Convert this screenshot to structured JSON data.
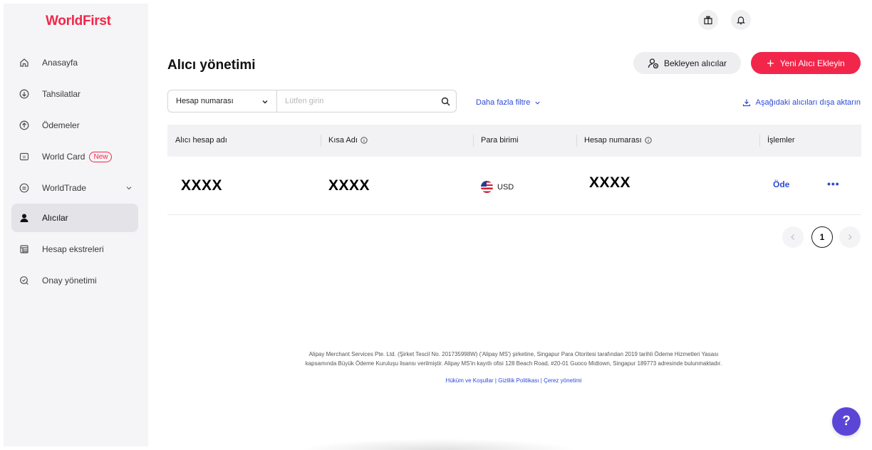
{
  "brand": {
    "logo": "WorldFirst",
    "accent": "#f2264b",
    "link_color": "#2e4bd6"
  },
  "sidebar": {
    "items": [
      {
        "label": "Anasayfa",
        "icon": "home-icon"
      },
      {
        "label": "Tahsilatlar",
        "icon": "download-circle-icon"
      },
      {
        "label": "Ödemeler",
        "icon": "upload-circle-icon"
      },
      {
        "label": "World Card",
        "icon": "card-icon",
        "badge": "New"
      },
      {
        "label": "WorldTrade",
        "icon": "trade-icon"
      },
      {
        "label": "Alıcılar",
        "icon": "user-icon",
        "active": true
      },
      {
        "label": "Hesap ekstreleri",
        "icon": "statement-icon"
      },
      {
        "label": "Onay yönetimi",
        "icon": "approval-icon"
      }
    ]
  },
  "header": {
    "icons": [
      "gift-icon",
      "bell-icon"
    ]
  },
  "page": {
    "title": "Alıcı yönetimi",
    "pending_button": "Bekleyen alıcılar",
    "add_button": "Yeni Alıcı Ekleyin"
  },
  "filter": {
    "select_value": "Hesap numarası",
    "placeholder": "Lütfen girin",
    "more_filters": "Daha fazla filtre",
    "export": "Aşağıdaki alıcıları dışa aktarın"
  },
  "table": {
    "headers": [
      "Alıcı hesap adı",
      "Kısa Adı",
      "Para birimi",
      "Hesap numarası",
      "İşlemler"
    ],
    "rows": [
      {
        "account_name": "XXXX",
        "short_name": "XXXX",
        "currency": "USD",
        "account_number": "XXXX",
        "action": "Öde",
        "more": "•••"
      }
    ]
  },
  "pagination": {
    "current": "1"
  },
  "footer": {
    "legal_line1": "Alipay Merchant Services Pte. Ltd. (Şirket Tescil No. 201735998W) ('Alipay MS') şirketine, Singapur Para Otoritesi tarafından 2019 tarihli Ödeme Hizmetleri Yasası",
    "legal_line2": "kapsamında Büyük Ödeme Kuruluşu lisansı verilmiştir. Alipay MS'in kayıtlı ofisi 128 Beach Road, #20-01 Guoco Midtown, Singapur 189773 adresinde bulunmaktadır.",
    "links": "Hüküm ve Koşullar | Gizlilik Politikası | Çerez yönetimi"
  },
  "help": {
    "label": "?"
  }
}
